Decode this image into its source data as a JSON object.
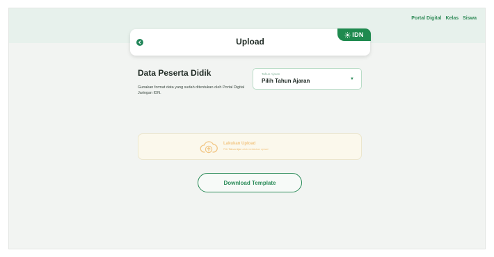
{
  "nav": {
    "items": [
      "Portal Digital",
      "Kelas",
      "Siswa"
    ]
  },
  "header": {
    "title": "Upload",
    "logo_text": "IDN"
  },
  "section": {
    "title": "Data Peserta Didik",
    "description": "Gunakan format data yang sudah ditentukan oleh Portal Digital Jaringan IDN."
  },
  "year_select": {
    "label": "Tahun Ajaran",
    "value": "Pilih Tahun Ajaran"
  },
  "upload": {
    "title": "Lakukan Upload",
    "subtitle_prefix": "Pilih",
    "subtitle_highlight": "Tahun Ajar",
    "subtitle_suffix": "untuk melakukan upload"
  },
  "download": {
    "label": "Download Template"
  },
  "colors": {
    "brand_green": "#1f8a4f",
    "upload_accent": "#f2c684",
    "background": "#f2f4f2"
  }
}
